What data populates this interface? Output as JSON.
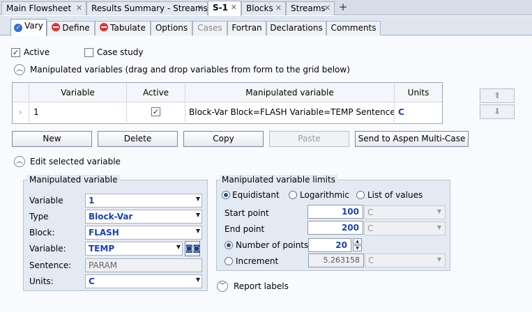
{
  "doc_tabs": [
    {
      "label": "Main Flowsheet"
    },
    {
      "label": "Results Summary - Streams"
    },
    {
      "label": "S-1"
    },
    {
      "label": "Blocks"
    },
    {
      "label": "Streams"
    }
  ],
  "form_tabs": [
    {
      "label": "Vary",
      "status": "ok"
    },
    {
      "label": "Define",
      "status": "incomplete"
    },
    {
      "label": "Tabulate",
      "status": "incomplete"
    },
    {
      "label": "Options"
    },
    {
      "label": "Cases",
      "disabled": true
    },
    {
      "label": "Fortran"
    },
    {
      "label": "Declarations"
    },
    {
      "label": "Comments"
    }
  ],
  "options": {
    "active_label": "Active",
    "active_checked": true,
    "case_study_label": "Case study",
    "case_study_checked": false
  },
  "manipulated_section": {
    "title": "Manipulated variables (drag and drop variables from form to the grid below)"
  },
  "grid": {
    "headers": [
      "Variable",
      "Active",
      "Manipulated variable",
      "Units"
    ],
    "rows": [
      {
        "variable": "1",
        "active": true,
        "manipulated": "Block-Var Block=FLASH Variable=TEMP Sentence=P...",
        "units": "C"
      }
    ]
  },
  "buttons": {
    "new": "New",
    "delete": "Delete",
    "copy": "Copy",
    "paste": "Paste",
    "send": "Send to Aspen Multi-Case"
  },
  "edit_section": {
    "title": "Edit selected variable"
  },
  "manip_var": {
    "title": "Manipulated variable",
    "variable_label": "Variable",
    "variable_value": "1",
    "type_label": "Type",
    "type_value": "Block-Var",
    "block_label": "Block:",
    "block_value": "FLASH",
    "variable2_label": "Variable:",
    "variable2_value": "TEMP",
    "sentence_label": "Sentence:",
    "sentence_value": "PARAM",
    "units_label": "Units:",
    "units_value": "C"
  },
  "limits": {
    "title": "Manipulated variable limits",
    "spacing": [
      "Equidistant",
      "Logarithmic",
      "List of values"
    ],
    "spacing_selected": "Equidistant",
    "start_label": "Start point",
    "start_value": "100",
    "start_units": "C",
    "end_label": "End point",
    "end_value": "200",
    "end_units": "C",
    "npoints_label": "Number of points",
    "npoints_value": "20",
    "increment_label": "Increment",
    "increment_value": "5.263158",
    "increment_units": "C"
  },
  "report_labels": "Report labels"
}
